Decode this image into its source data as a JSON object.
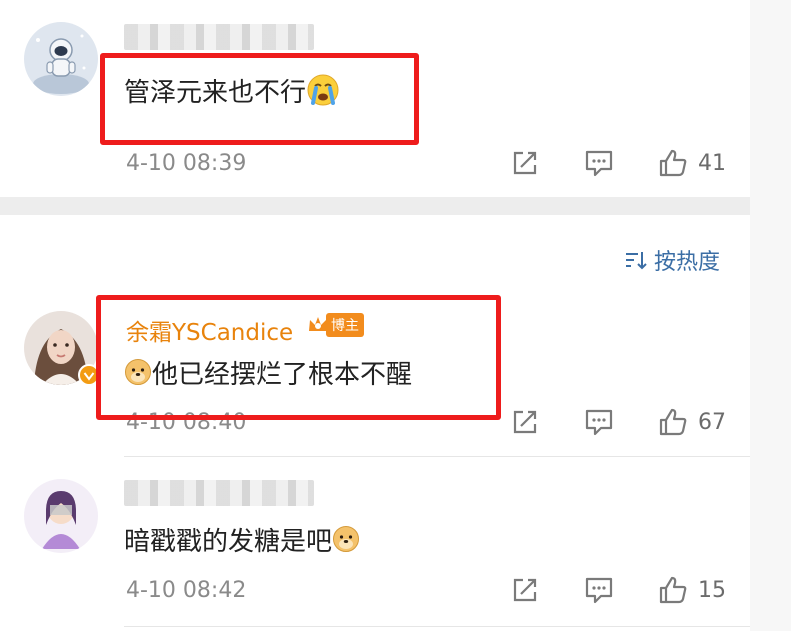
{
  "comments": [
    {
      "text": "管泽元来也不行",
      "emoji": "crying-face",
      "time": "4-10 08:39",
      "likes": "41"
    },
    {
      "author": "余霜YSCandice",
      "badge": "博主",
      "text": "他已经摆烂了根本不醒",
      "emoji": "doge",
      "time": "4-10 08:40",
      "likes": "67"
    },
    {
      "text": "暗戳戳的发糖是吧",
      "emoji": "doge",
      "time": "4-10 08:42",
      "likes": "15"
    }
  ],
  "sort": {
    "label": "按热度"
  },
  "colors": {
    "highlight_box": "#ee1c1c",
    "author_name": "#e8830c",
    "sort_link": "#3b6ea5"
  }
}
